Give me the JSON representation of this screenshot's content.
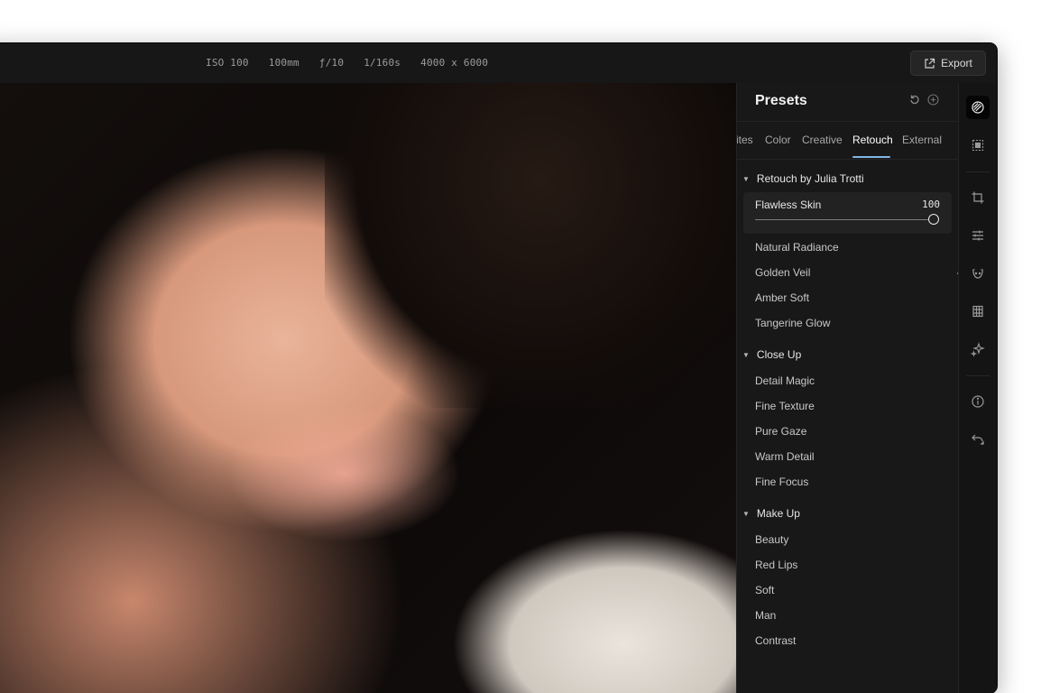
{
  "topbar": {
    "exif": [
      "ISO 100",
      "100mm",
      "ƒ/10",
      "1/160s",
      "4000 x 6000"
    ],
    "export_label": "Export"
  },
  "panel": {
    "title": "Presets",
    "tabs": [
      {
        "label": "ites",
        "active": false
      },
      {
        "label": "Color",
        "active": false
      },
      {
        "label": "Creative",
        "active": false
      },
      {
        "label": "Retouch",
        "active": true
      },
      {
        "label": "External",
        "active": false
      }
    ],
    "groups": [
      {
        "title": "Retouch by Julia Trotti",
        "selected": {
          "name": "Flawless Skin",
          "value": "100",
          "level": 1.0
        },
        "items": [
          "Natural Radiance",
          "Golden Veil",
          "Amber Soft",
          "Tangerine Glow"
        ]
      },
      {
        "title": "Close Up",
        "items": [
          "Detail Magic",
          "Fine Texture",
          "Pure Gaze",
          "Warm Detail",
          "Fine Focus"
        ]
      },
      {
        "title": "Make Up",
        "items": [
          "Beauty",
          "Red Lips",
          "Soft",
          "Man",
          "Contrast"
        ]
      }
    ]
  },
  "toolbar": {
    "tools": [
      "presets-icon",
      "mask-select-icon",
      "crop-icon",
      "adjustments-icon",
      "face-retouch-icon",
      "layers-icon",
      "ai-sparkle-icon",
      "info-icon",
      "undo-icon"
    ]
  },
  "colors": {
    "accent": "#7fb6e6",
    "background": "#181818"
  }
}
